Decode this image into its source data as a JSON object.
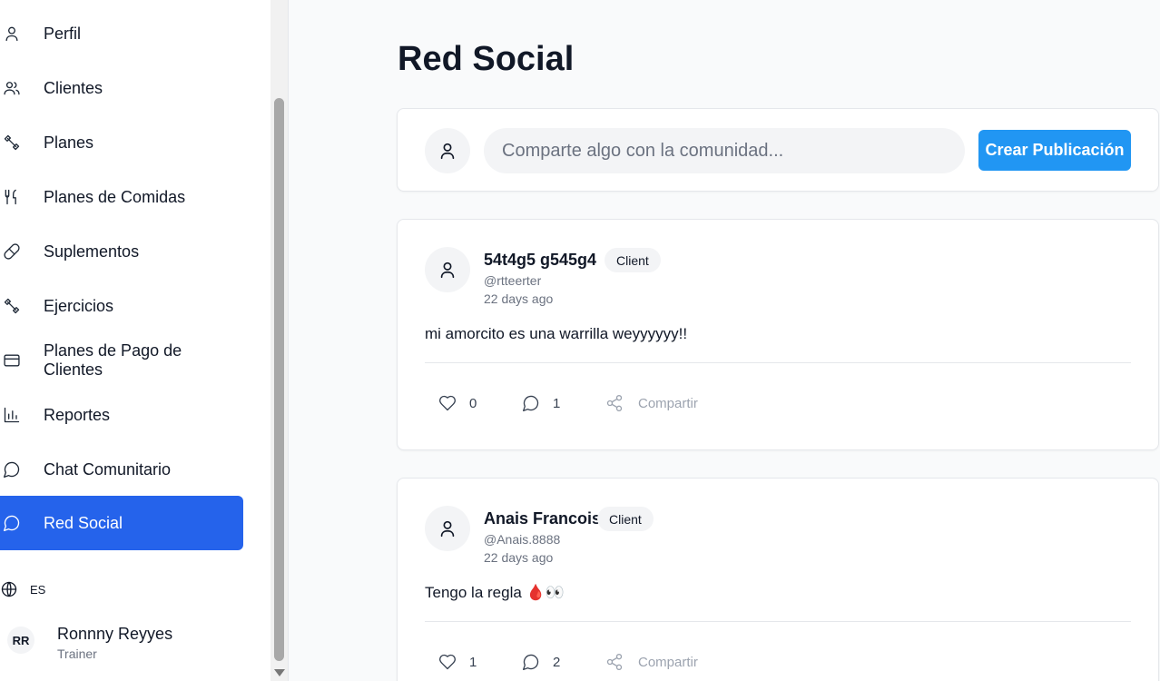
{
  "sidebar": {
    "items": [
      {
        "label": "Perfil",
        "icon": "user-icon"
      },
      {
        "label": "Clientes",
        "icon": "users-icon"
      },
      {
        "label": "Planes",
        "icon": "dumbbell-icon"
      },
      {
        "label": "Planes de Comidas",
        "icon": "utensils-icon"
      },
      {
        "label": "Suplementos",
        "icon": "pill-icon"
      },
      {
        "label": "Ejercicios",
        "icon": "dumbbell-icon"
      },
      {
        "label": "Planes de Pago de Clientes",
        "icon": "credit-card-icon"
      },
      {
        "label": "Reportes",
        "icon": "bar-chart-icon"
      },
      {
        "label": "Chat Comunitario",
        "icon": "message-circle-icon"
      },
      {
        "label": "Red Social",
        "icon": "message-circle-icon",
        "active": true
      }
    ],
    "language": "ES",
    "user": {
      "initials": "RR",
      "name": "Ronnny Reyyes",
      "role": "Trainer"
    }
  },
  "main": {
    "title": "Red Social",
    "composer": {
      "placeholder": "Comparte algo con la comunidad...",
      "button_label": "Crear Publicación"
    },
    "posts": [
      {
        "name": "54t4g5 g545g4",
        "badge": "Client",
        "handle": "@rtteerter",
        "time": "22 days ago",
        "text": "mi amorcito es una warrilla weyyyyyy!!",
        "likes": "0",
        "comments": "1",
        "share_label": "Compartir"
      },
      {
        "name": "Anais Francois",
        "badge": "Client",
        "handle": "@Anais.8888",
        "time": "22 days ago",
        "text": "Tengo la regla 🩸👀",
        "likes": "1",
        "comments": "2",
        "share_label": "Compartir"
      }
    ]
  },
  "colors": {
    "accent": "#2563eb",
    "button": "#2196f3"
  }
}
